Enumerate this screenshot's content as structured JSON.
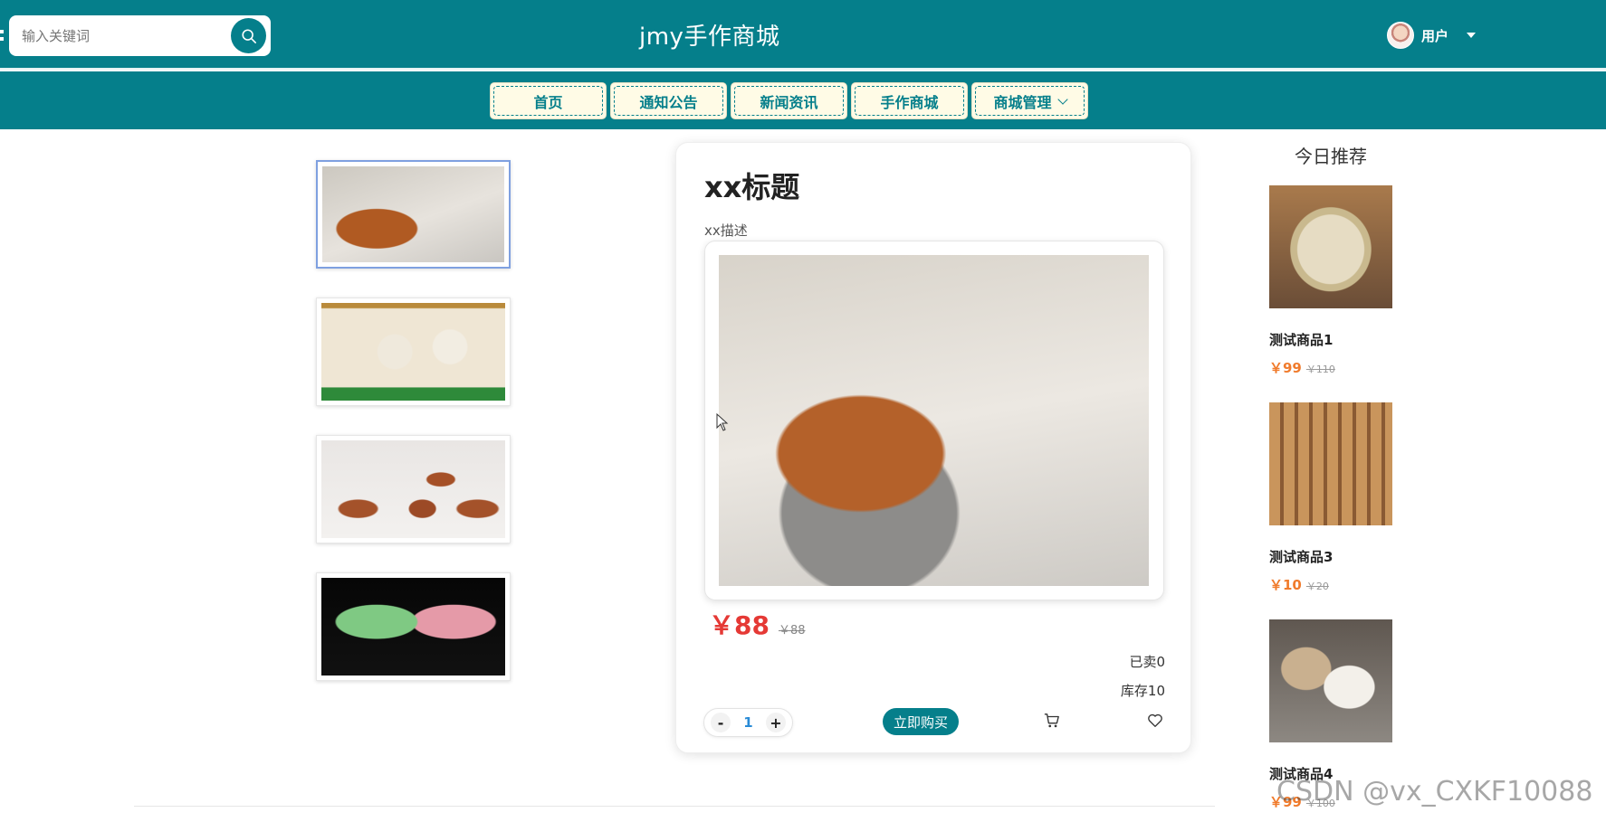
{
  "header": {
    "site_title": "jmy手作商城",
    "search_placeholder": "输入关键词",
    "user_label": "用户"
  },
  "nav": {
    "items": [
      {
        "label": "首页"
      },
      {
        "label": "通知公告"
      },
      {
        "label": "新闻资讯"
      },
      {
        "label": "手作商城"
      },
      {
        "label": "商城管理"
      }
    ]
  },
  "product": {
    "title": "xx标题",
    "description": "xx描述",
    "price": "￥88",
    "original_price": "￥88",
    "sold": "已卖0",
    "stock": "库存10",
    "quantity": "1",
    "buy_label": "立即购买"
  },
  "recommend": {
    "title": "今日推荐",
    "items": [
      {
        "name": "测试商品1",
        "price": "￥99",
        "original_price": "￥110"
      },
      {
        "name": "测试商品3",
        "price": "￥10",
        "original_price": "￥20"
      },
      {
        "name": "测试商品4",
        "price": "￥99",
        "original_price": "￥100"
      }
    ]
  },
  "watermark": "CSDN @vx_CXKF10088",
  "colors": {
    "primary": "#057f8b",
    "price_red": "#e53935",
    "rec_price_orange": "#f07b2c",
    "nav_button_bg": "#fffbe6"
  }
}
